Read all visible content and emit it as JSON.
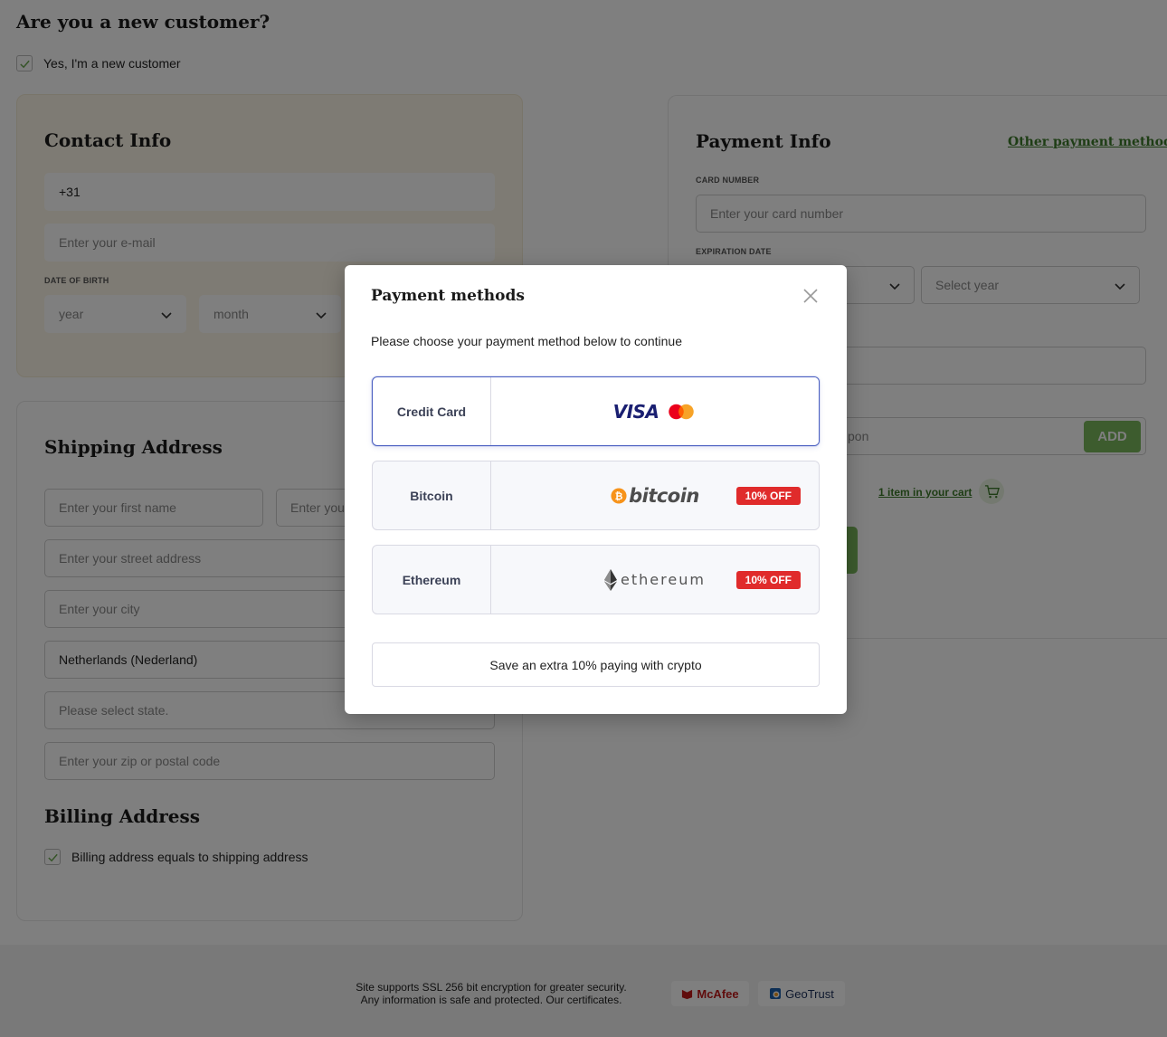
{
  "new_customer": {
    "heading": "Are you a new customer?",
    "checkbox_label": "Yes, I'm a new customer",
    "checked": true
  },
  "contact": {
    "title": "Contact Info",
    "phone_value": "+31",
    "email_placeholder": "Enter your e-mail",
    "dob_label": "DATE OF BIRTH",
    "dob_year": "year",
    "dob_month": "month"
  },
  "shipping": {
    "title": "Shipping Address",
    "first_name_placeholder": "Enter your first name",
    "last_name_partial": "Enter your",
    "street_placeholder": "Enter your street address",
    "city_placeholder": "Enter your city",
    "country_value": "Netherlands (Nederland)",
    "state_placeholder": "Please select state.",
    "zip_placeholder": "Enter your zip or postal code"
  },
  "billing": {
    "title": "Billing Address",
    "checkbox_label": "Billing address equals to shipping address",
    "checked": true
  },
  "payment": {
    "title": "Payment Info",
    "other_method_link": "Other payment method",
    "card_number_label": "CARD NUMBER",
    "card_number_placeholder": "Enter your card number",
    "expiration_label": "EXPIRATION DATE",
    "year_placeholder": "Select year",
    "coupon_partial": "pon",
    "add_button": "ADD",
    "cart_link": "1 item in your cart"
  },
  "footer": {
    "line1": "Site supports SSL 256 bit encryption for greater security.",
    "line2": "Any information is safe and protected. Our certificates.",
    "badge_mcafee": "McAfee",
    "badge_geotrust": "GeoTrust"
  },
  "modal": {
    "title": "Payment methods",
    "subtitle": "Please choose your payment method below to continue",
    "options": [
      {
        "name": "Credit Card",
        "logo_text": "VISA",
        "selected": true,
        "discount": ""
      },
      {
        "name": "Bitcoin",
        "logo_text": "bitcoin",
        "selected": false,
        "discount": "10% OFF"
      },
      {
        "name": "Ethereum",
        "logo_text": "ethereum",
        "selected": false,
        "discount": "10% OFF"
      }
    ],
    "save_note": "Save an extra 10% paying with crypto",
    "close_icon": "close-icon"
  },
  "colors": {
    "brand_green": "#7ab85c",
    "link_green": "#3d7a2a",
    "selected_border": "#4a5fc1",
    "discount_red": "#e02b2b",
    "bitcoin_orange": "#f7931a",
    "visa_blue": "#1a1f71"
  }
}
